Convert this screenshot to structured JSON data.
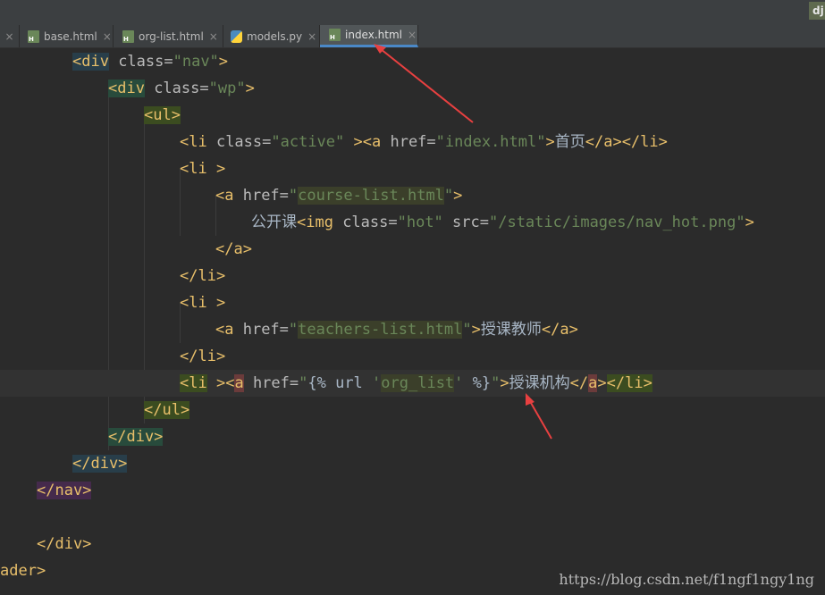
{
  "corner_badge": "dj",
  "tabs": [
    {
      "label": "base.html",
      "icon": "html-file-icon",
      "active": false
    },
    {
      "label": "org-list.html",
      "icon": "html-file-icon",
      "active": false
    },
    {
      "label": "models.py",
      "icon": "python-file-icon",
      "active": false
    },
    {
      "label": "index.html",
      "icon": "html-file-icon",
      "active": true
    }
  ],
  "code": {
    "l1": {
      "open": "<div",
      "attr": " class=",
      "val": "\"nav\"",
      "close": ">"
    },
    "l2": {
      "open": "<div",
      "attr": " class=",
      "val": "\"wp\"",
      "close": ">"
    },
    "l3": {
      "tag": "<ul>"
    },
    "l4": {
      "li": "<li",
      "attr": " class=",
      "val": "\"active\"",
      "sp": " >",
      "a": "<a",
      "href": " href=",
      "hval": "\"index.html\"",
      "gt": ">",
      "text": "首页",
      "ca": "</a>",
      "cli": "</li>"
    },
    "l5": {
      "li": "<li",
      "sp": " >"
    },
    "l6": {
      "a": "<a",
      "href": " href=",
      "q1": "\"",
      "hval": "course-list.html",
      "q2": "\"",
      "gt": ">"
    },
    "l7": {
      "text": "公开课",
      "img": "<img",
      "attr": " class=",
      "val": "\"hot\"",
      "src": " src=",
      "sval": "\"/static/images/nav_hot.png\"",
      "gt": ">"
    },
    "l8": {
      "ca": "</a>"
    },
    "l9": {
      "cli": "</li>"
    },
    "l10": {
      "li": "<li",
      "sp": " >"
    },
    "l11": {
      "a": "<a",
      "href": " href=",
      "q1": "\"",
      "hval": "teachers-list.html",
      "q2": "\"",
      "gt": ">",
      "text": "授课教师",
      "ca": "</a>"
    },
    "l12": {
      "cli": "</li>"
    },
    "l13": {
      "li": "<li",
      "sp": " >",
      "lt": "<",
      "a": "a",
      "href": " href=",
      "q1": "\"",
      "tpl1": "{% url ",
      "s1": "'",
      "name": "org_list",
      "s2": "'",
      "tpl2": " %}",
      "q2": "\"",
      "gt": ">",
      "text": "授课机构",
      "ca1": "</",
      "ca2": "a",
      "ca3": ">",
      "cli": "</li>"
    },
    "l14": {
      "tag": "</ul>"
    },
    "l15": {
      "tag": "</div>"
    },
    "l16": {
      "tag": "</div>"
    },
    "l17": {
      "tag": "</nav>"
    },
    "l19": {
      "tag": "</div>"
    },
    "l20": {
      "frag": "ader",
      "gt": ">"
    }
  },
  "watermark": "https://blog.csdn.net/f1ngf1ngy1ng",
  "colors": {
    "tag": "#e8bf6a",
    "attr": "#bababa",
    "string": "#6a8759",
    "text": "#a9b7c6",
    "background": "#2b2b2b",
    "arrow": "#e84040"
  }
}
